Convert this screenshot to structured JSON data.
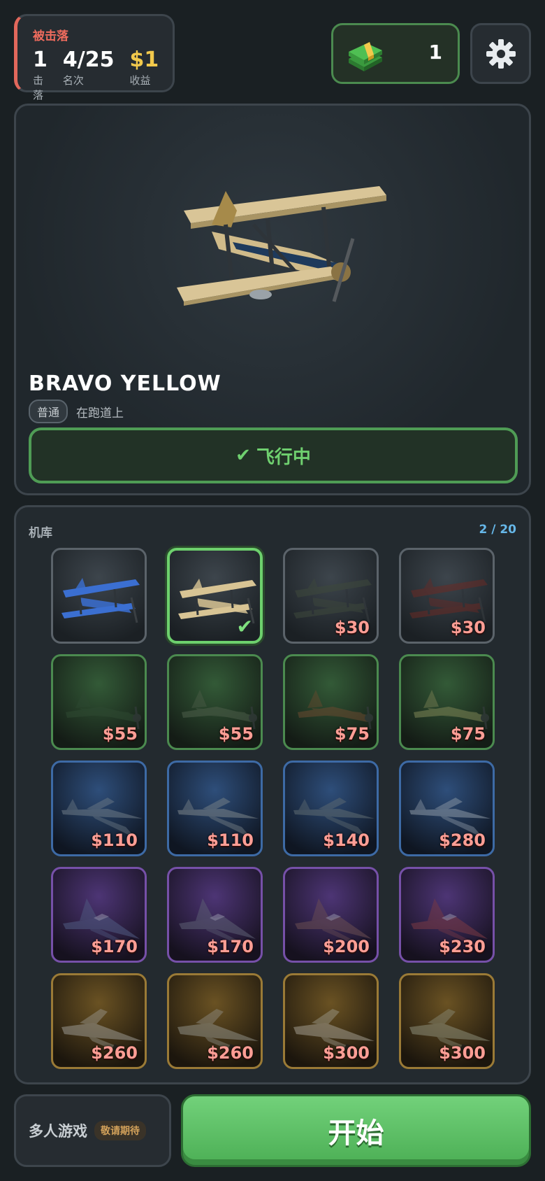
{
  "status": {
    "title": "被击落",
    "stats": [
      {
        "value": "1",
        "label": "击落"
      },
      {
        "value": "4/25",
        "label": "名次"
      },
      {
        "value": "$1",
        "label": "收益"
      }
    ]
  },
  "cash": {
    "amount": "1",
    "icon": "cash-stack-icon"
  },
  "settings": {
    "icon": "gear-icon"
  },
  "showcase": {
    "plane_name": "BRAVO YELLOW",
    "rarity": "普通",
    "location": "在跑道上",
    "action_icon": "✔",
    "action_label": "飞行中"
  },
  "hangar": {
    "title": "机库",
    "count": "2 / 20",
    "planes": [
      {
        "tier": "gray",
        "type": "biplane",
        "color": "#3b6fd1",
        "price": "",
        "state": "owned"
      },
      {
        "tier": "gray",
        "type": "biplane",
        "color": "#d8c494",
        "price": "",
        "state": "selected"
      },
      {
        "tier": "gray",
        "type": "biplane",
        "color": "#3f4a3c",
        "price": "$30",
        "state": "locked"
      },
      {
        "tier": "gray",
        "type": "biplane",
        "color": "#6a2a25",
        "price": "$30",
        "state": "locked"
      },
      {
        "tier": "green",
        "type": "prop",
        "color": "#2f4a32",
        "price": "$55",
        "state": "locked"
      },
      {
        "tier": "green",
        "type": "prop",
        "color": "#4d5e4a",
        "price": "$55",
        "state": "locked"
      },
      {
        "tier": "green",
        "type": "prop",
        "color": "#6b4a30",
        "price": "$75",
        "state": "locked"
      },
      {
        "tier": "green",
        "type": "prop",
        "color": "#7f8656",
        "price": "$75",
        "state": "locked"
      },
      {
        "tier": "blue",
        "type": "jet",
        "color": "#6d7a86",
        "price": "$110",
        "state": "locked"
      },
      {
        "tier": "blue",
        "type": "jet",
        "color": "#7c858a",
        "price": "$110",
        "state": "locked"
      },
      {
        "tier": "blue",
        "type": "jet",
        "color": "#5f6c72",
        "price": "$140",
        "state": "locked"
      },
      {
        "tier": "blue",
        "type": "jet",
        "color": "#8d99a6",
        "price": "$280",
        "state": "locked"
      },
      {
        "tier": "purple",
        "type": "fighter",
        "color": "#505b82",
        "price": "$170",
        "state": "locked"
      },
      {
        "tier": "purple",
        "type": "fighter",
        "color": "#5d6074",
        "price": "$170",
        "state": "locked"
      },
      {
        "tier": "purple",
        "type": "fighter",
        "color": "#6a4e52",
        "price": "$200",
        "state": "locked"
      },
      {
        "tier": "purple",
        "type": "fighter",
        "color": "#7a3a44",
        "price": "$230",
        "state": "locked"
      },
      {
        "tier": "gold",
        "type": "stealth",
        "color": "#9a9890",
        "price": "$260",
        "state": "locked"
      },
      {
        "tier": "gold",
        "type": "stealth",
        "color": "#8f8e86",
        "price": "$260",
        "state": "locked"
      },
      {
        "tier": "gold",
        "type": "stealth",
        "color": "#a09c8e",
        "price": "$300",
        "state": "locked"
      },
      {
        "tier": "gold",
        "type": "stealth",
        "color": "#8a8c78",
        "price": "$300",
        "state": "locked"
      }
    ]
  },
  "bottom": {
    "multiplayer_label": "多人游戏",
    "coming_soon": "敬请期待",
    "start_label": "开始"
  }
}
